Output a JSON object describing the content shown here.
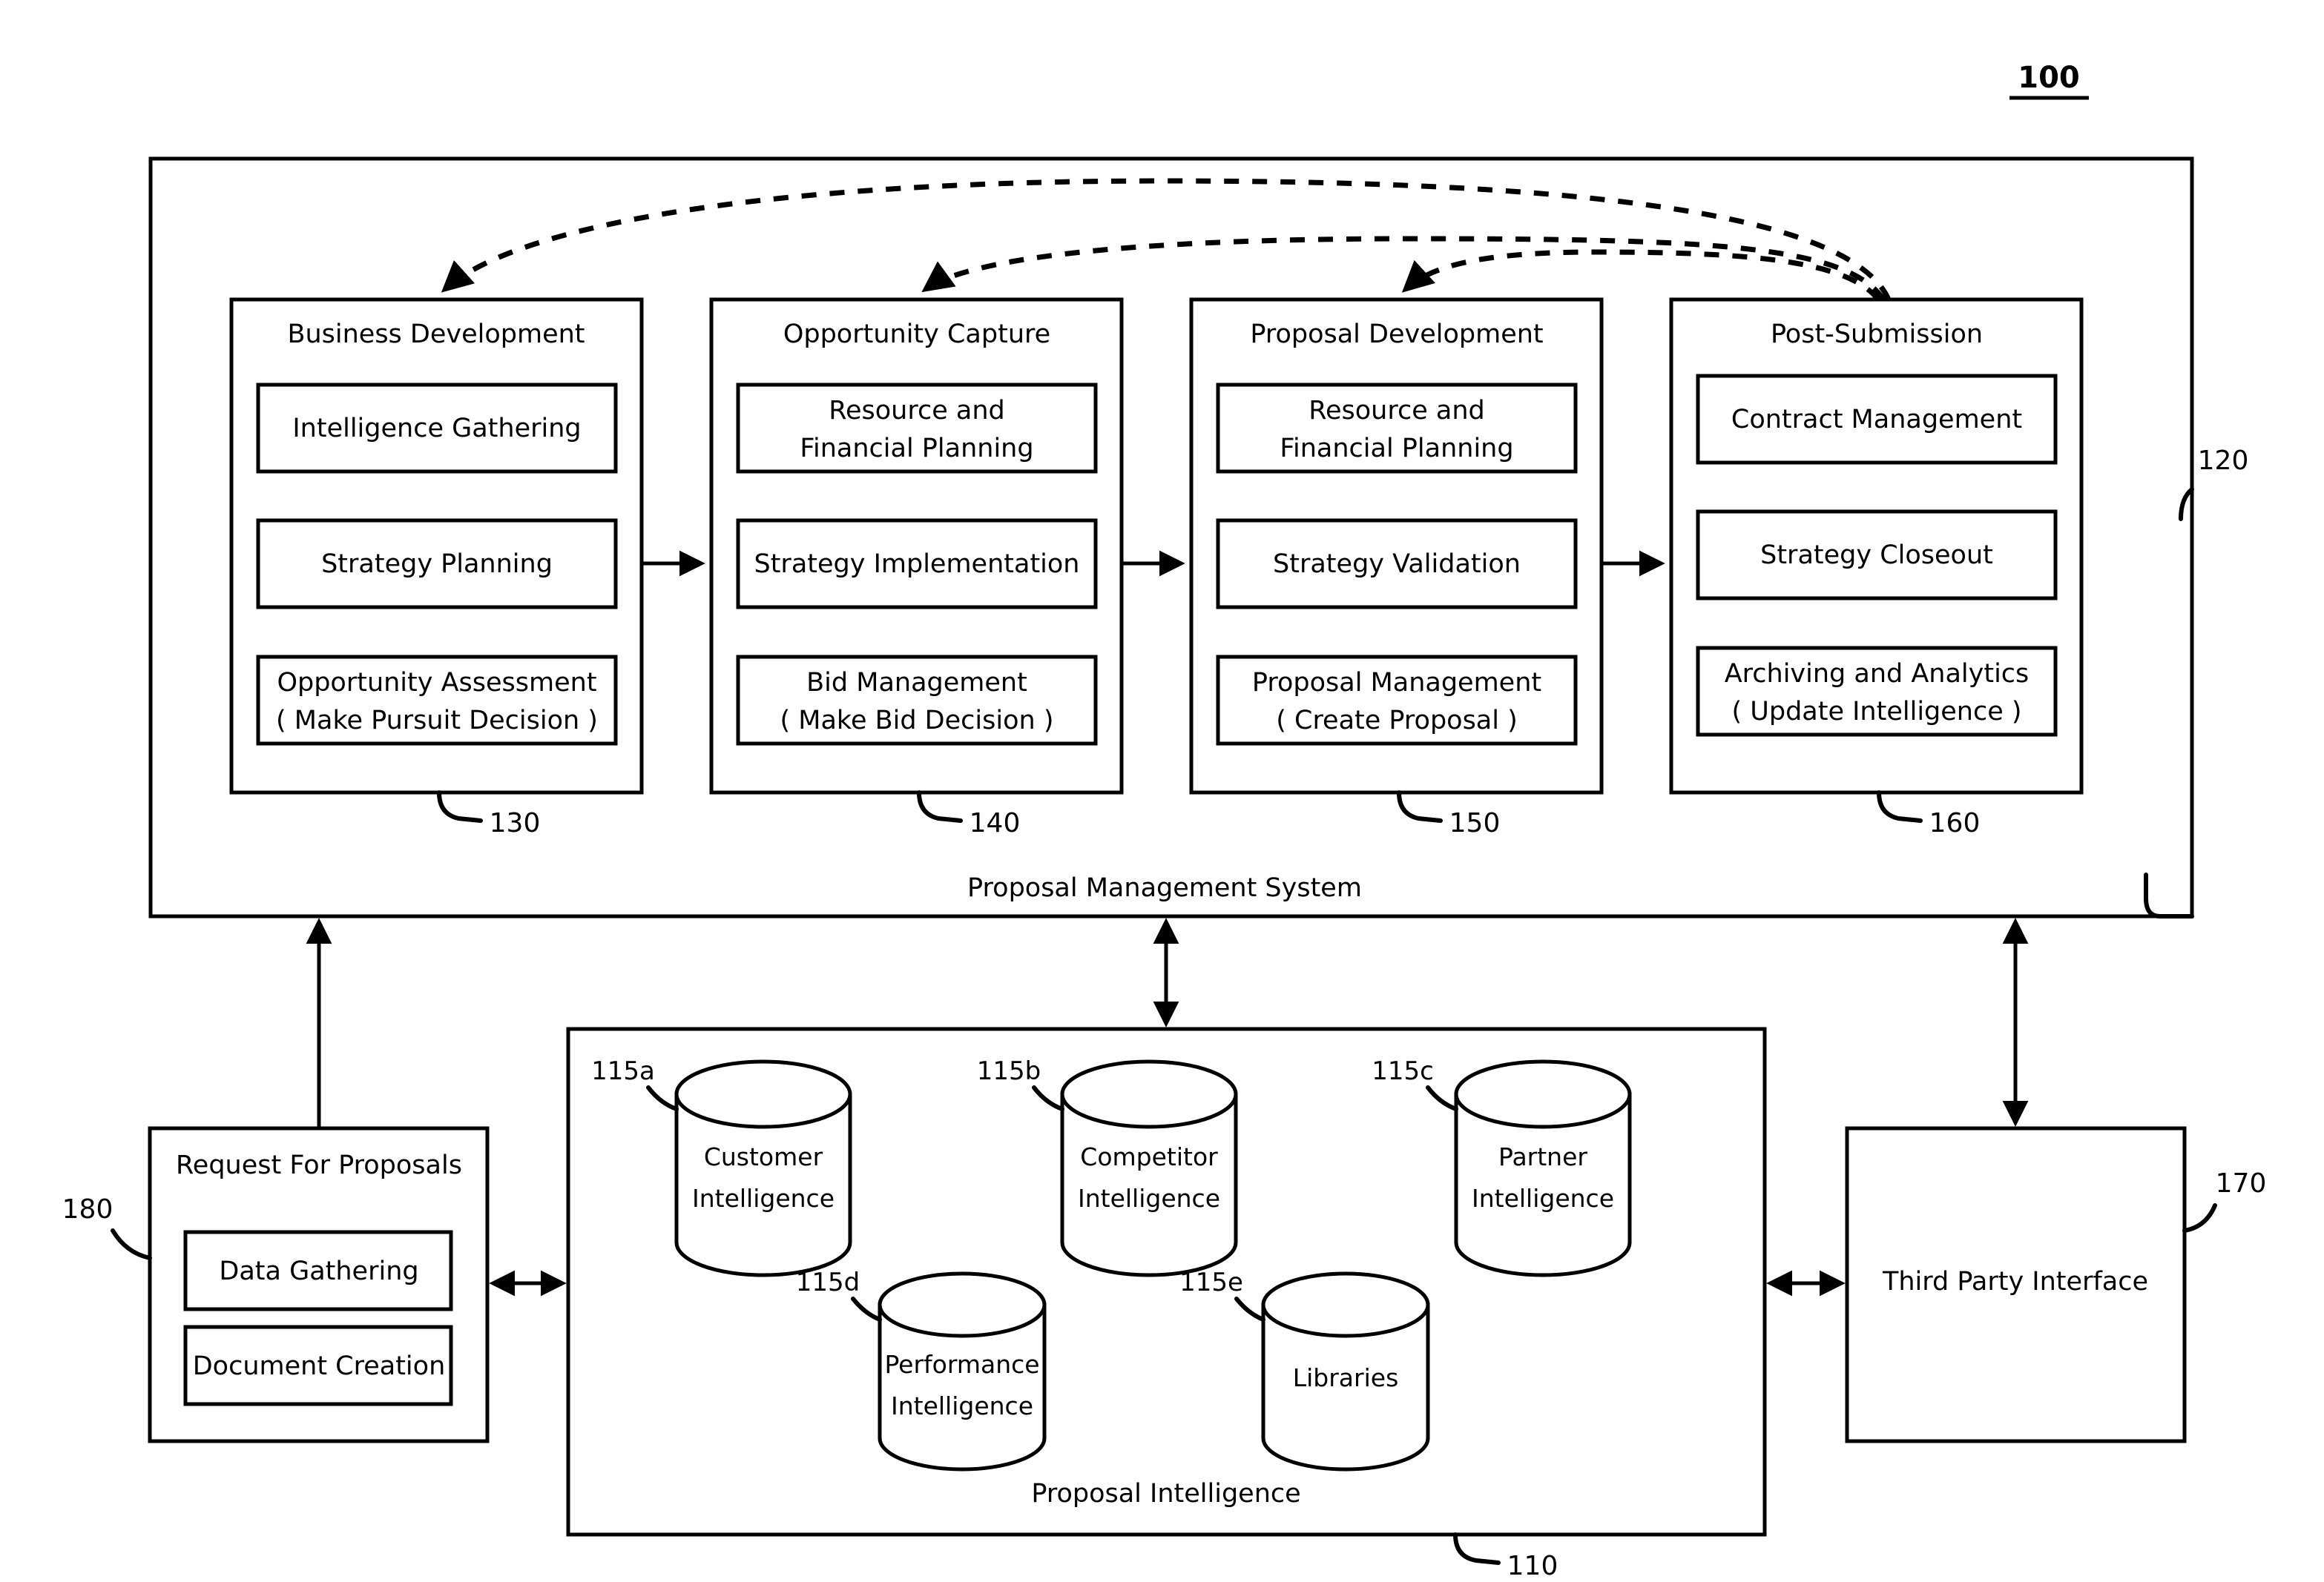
{
  "figure": {
    "number": "100"
  },
  "proposal_management_system": {
    "ref": "120",
    "caption": "Proposal Management System",
    "stages": [
      {
        "ref": "130",
        "title": "Business Development",
        "items": [
          {
            "lines": [
              "Intelligence Gathering"
            ]
          },
          {
            "lines": [
              "Strategy Planning"
            ]
          },
          {
            "lines": [
              "Opportunity Assessment",
              "( Make Pursuit Decision )"
            ]
          }
        ]
      },
      {
        "ref": "140",
        "title": "Opportunity Capture",
        "items": [
          {
            "lines": [
              "Resource and",
              "Financial Planning"
            ]
          },
          {
            "lines": [
              "Strategy Implementation"
            ]
          },
          {
            "lines": [
              "Bid Management",
              "( Make Bid Decision )"
            ]
          }
        ]
      },
      {
        "ref": "150",
        "title": "Proposal Development",
        "items": [
          {
            "lines": [
              "Resource and",
              "Financial Planning"
            ]
          },
          {
            "lines": [
              "Strategy Validation"
            ]
          },
          {
            "lines": [
              "Proposal Management",
              "( Create Proposal )"
            ]
          }
        ]
      },
      {
        "ref": "160",
        "title": "Post-Submission",
        "items": [
          {
            "lines": [
              "Contract Management"
            ]
          },
          {
            "lines": [
              "Strategy Closeout"
            ]
          },
          {
            "lines": [
              "Archiving and Analytics",
              "( Update Intelligence )"
            ]
          }
        ]
      }
    ]
  },
  "proposal_intelligence": {
    "ref": "110",
    "caption": "Proposal Intelligence",
    "databases": [
      {
        "ref": "115a",
        "lines": [
          "Customer",
          "Intelligence"
        ]
      },
      {
        "ref": "115b",
        "lines": [
          "Competitor",
          "Intelligence"
        ]
      },
      {
        "ref": "115c",
        "lines": [
          "Partner",
          "Intelligence"
        ]
      },
      {
        "ref": "115d",
        "lines": [
          "Performance",
          "Intelligence"
        ]
      },
      {
        "ref": "115e",
        "lines": [
          "Libraries"
        ]
      }
    ]
  },
  "request_for_proposals": {
    "ref": "180",
    "title": "Request For Proposals",
    "items": [
      "Data Gathering",
      "Document Creation"
    ]
  },
  "third_party_interface": {
    "ref": "170",
    "title": "Third Party Interface"
  },
  "colors": {
    "line": "#000000",
    "background": "#ffffff"
  }
}
